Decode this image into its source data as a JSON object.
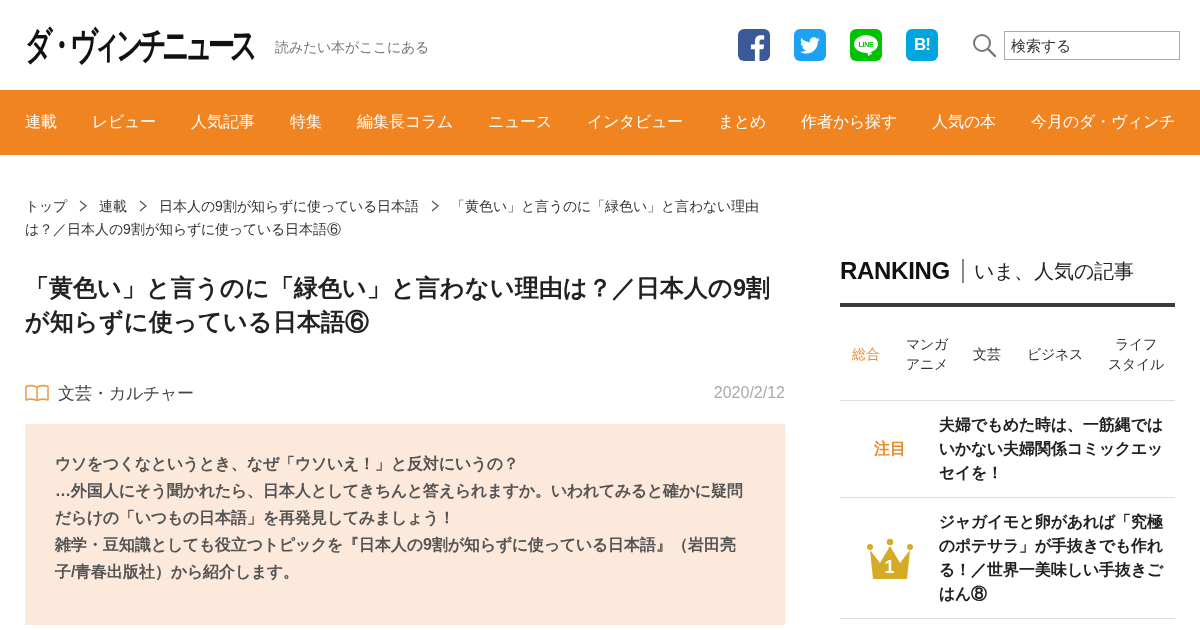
{
  "header": {
    "logo": "ダ・ヴィンチニュース",
    "tagline": "読みたい本がここにある",
    "social": [
      {
        "kind": "facebook"
      },
      {
        "kind": "twitter"
      },
      {
        "kind": "line",
        "label": "LINE"
      },
      {
        "kind": "hatena",
        "label": "B!"
      }
    ],
    "search": {
      "placeholder": "検索する"
    }
  },
  "nav": [
    "連載",
    "レビュー",
    "人気記事",
    "特集",
    "編集長コラム",
    "ニュース",
    "インタビュー",
    "まとめ",
    "作者から探す",
    "人気の本",
    "今月のダ・ヴィンチ"
  ],
  "breadcrumb": [
    "トップ",
    "連載",
    "日本人の9割が知らずに使っている日本語",
    "「黄色い」と言うのに「緑色い」と言わない理由は？／日本人の9割が知らずに使っている日本語⑥"
  ],
  "article": {
    "title": "「黄色い」と言うのに「緑色い」と言わない理由は？／日本人の9割が知らずに使っている日本語⑥",
    "category": "文芸・カルチャー",
    "date": "2020/2/12",
    "lead": [
      "ウソをつくなというとき、なぜ「ウソいえ！」と反対にいうの？",
      "…外国人にそう聞かれたら、日本人としてきちんと答えられますか。いわれてみると確かに疑問だらけの「いつもの日本語」を再発見してみましょう！",
      "雑学・豆知識としても役立つトピックを『日本人の9割が知らずに使っている日本語』（岩田亮子/青春出版社）から紹介します。"
    ]
  },
  "ranking": {
    "title": "RANKING",
    "subtitle": "いま、人気の記事",
    "tabs": [
      {
        "lines": [
          "総合"
        ],
        "selected": true
      },
      {
        "lines": [
          "マンガ",
          "アニメ"
        ],
        "selected": false
      },
      {
        "lines": [
          "文芸"
        ],
        "selected": false
      },
      {
        "lines": [
          "ビジネス"
        ],
        "selected": false
      },
      {
        "lines": [
          "ライフ",
          "スタイル"
        ],
        "selected": false
      }
    ],
    "items": [
      {
        "kind": "featured",
        "label": "注目",
        "title": "夫婦でもめた時は、一筋縄ではいかない夫婦関係コミックエッセイを！"
      },
      {
        "kind": "rank",
        "label": "1",
        "title": "ジャガイモと卵があれば「究極のポテサラ」が手抜きでも作れる！／世界一美味しい手抜きごはん⑧"
      }
    ]
  }
}
